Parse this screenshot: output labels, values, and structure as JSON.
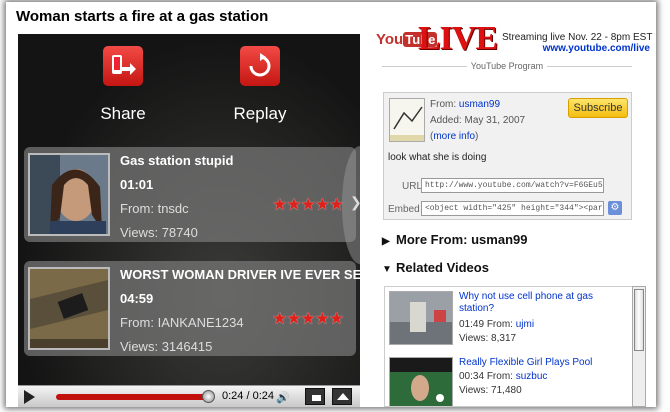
{
  "page_title": "Woman starts a fire at a gas station",
  "player": {
    "share_label": "Share",
    "replay_label": "Replay",
    "related": [
      {
        "title": "Gas station stupid",
        "duration": "01:01",
        "from_label": "From:",
        "from": "tnsdc",
        "views_label": "Views:",
        "views": "78740",
        "stars": "★★★★★"
      },
      {
        "title": "WORST WOMAN DRIVER IVE EVER SEEN",
        "duration": "04:59",
        "from_label": "From:",
        "from": "IANKANE1234",
        "views_label": "Views:",
        "views": "3146415",
        "stars": "★★★★★"
      }
    ],
    "time": "0:24 / 0:24",
    "progress": 1.0
  },
  "right": {
    "logo_tube": "Tube",
    "logo_you": "You",
    "live": "LIVE",
    "streaming": "Streaming live Nov. 22 - 8pm EST",
    "live_url": "www.youtube.com/live",
    "program_label": "YouTube Program",
    "info": {
      "from_label": "From:",
      "from": "usman99",
      "added_label": "Added:",
      "added": "May 31, 2007",
      "more_info": "more info",
      "subscribe": "Subscribe",
      "description": "look what she is doing",
      "url_label": "URL",
      "url": "http://www.youtube.com/watch?v=F6GEu5K3zog",
      "embed_label": "Embed",
      "embed": "<object width=\"425\" height=\"344\"><param name=\"movie\" va"
    },
    "more_from": "More From: usman99",
    "related_videos": "Related Videos",
    "related": [
      {
        "title": "Why not use cell phone at gas station?",
        "duration": "01:49",
        "from_label": "From:",
        "from": "ujmi",
        "views": "Views: 8,317"
      },
      {
        "title": "Really Flexible Girl Plays Pool",
        "duration": "00:34",
        "from_label": "From:",
        "from": "suzbuc",
        "views": "Views: 71,480"
      }
    ]
  }
}
